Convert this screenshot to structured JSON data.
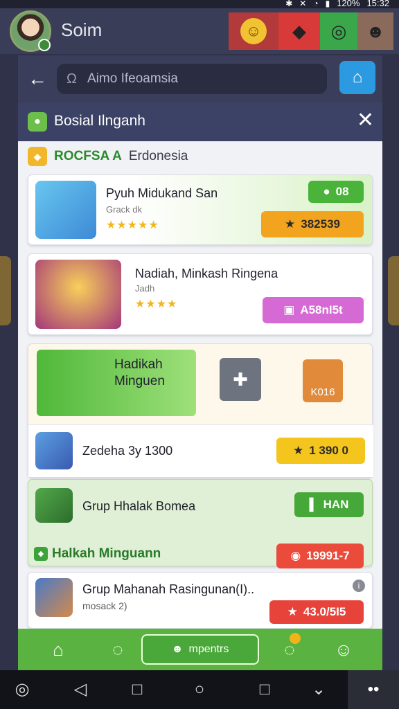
{
  "status": {
    "battery": "120%",
    "time": "15:32"
  },
  "app": {
    "name": "Soim"
  },
  "search": {
    "placeholder": "Aimo Ifeoamsia"
  },
  "modal": {
    "title": "Bosial Ilnganh"
  },
  "section": {
    "label_a": "ROCFSA A",
    "label_b": "Erdonesia"
  },
  "cards": [
    {
      "title": "Pyuh Midukand San",
      "subtitle": "Grack dk",
      "stars": "★★★★★",
      "badge": "08",
      "button": "382539"
    },
    {
      "title": "Nadiah, Minkash Ringena",
      "subtitle": "Jadh",
      "stars": "★★★★",
      "button": "A58nI5t"
    }
  ],
  "card3": {
    "title": "Hadikah Minguen",
    "box_label": "K016",
    "row_title": "Zedeha 3y 1300",
    "row_button": "1 390 0"
  },
  "card4": {
    "title": "Grup Hhalak Bomea",
    "button": "HAN",
    "section": "Halkah Minguann",
    "section_button": "19991-7"
  },
  "card5": {
    "title": "Grup Mahanah Rasingunan(I)..",
    "subtitle": "mosack 2)",
    "button": "43.0/5I5"
  },
  "nav": {
    "center_label": "mpentrs"
  },
  "icons": {
    "back": "arrow-left-icon",
    "home": "home-icon",
    "close": "close-icon",
    "star": "star-icon",
    "chat": "chat-icon",
    "profile": "profile-icon"
  }
}
